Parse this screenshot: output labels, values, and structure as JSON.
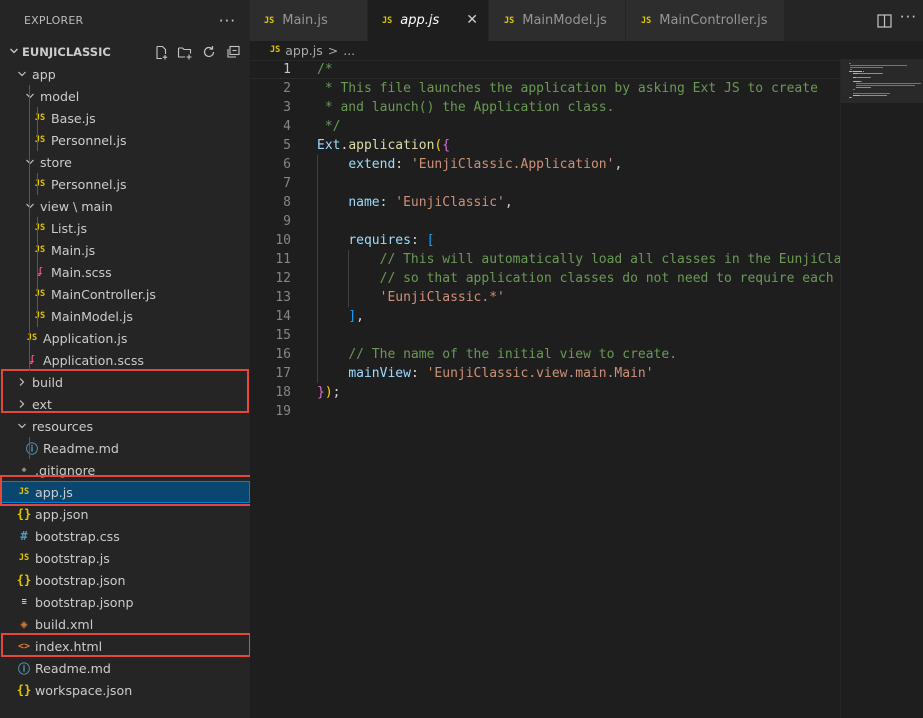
{
  "explorer": {
    "header_label": "EXPLORER",
    "more_icon": "ellipsis-icon",
    "project_name": "EUNJICLASSIC",
    "actions": [
      "new-file-icon",
      "new-folder-icon",
      "refresh-icon",
      "collapse-all-icon"
    ]
  },
  "tree": [
    {
      "label": "app",
      "kind": "folder",
      "expanded": true,
      "depth": 1
    },
    {
      "label": "model",
      "kind": "folder",
      "expanded": true,
      "depth": 2
    },
    {
      "label": "Base.js",
      "kind": "js",
      "depth": 3
    },
    {
      "label": "Personnel.js",
      "kind": "js",
      "depth": 3
    },
    {
      "label": "store",
      "kind": "folder",
      "expanded": true,
      "depth": 2
    },
    {
      "label": "Personnel.js",
      "kind": "js",
      "depth": 3
    },
    {
      "label": "view \\ main",
      "kind": "folder",
      "expanded": true,
      "depth": 2
    },
    {
      "label": "List.js",
      "kind": "js",
      "depth": 3
    },
    {
      "label": "Main.js",
      "kind": "js",
      "depth": 3
    },
    {
      "label": "Main.scss",
      "kind": "sass",
      "depth": 3
    },
    {
      "label": "MainController.js",
      "kind": "js",
      "depth": 3
    },
    {
      "label": "MainModel.js",
      "kind": "js",
      "depth": 3
    },
    {
      "label": "Application.js",
      "kind": "js",
      "depth": 2
    },
    {
      "label": "Application.scss",
      "kind": "sass",
      "depth": 2
    },
    {
      "label": "build",
      "kind": "folder",
      "expanded": false,
      "depth": 1
    },
    {
      "label": "ext",
      "kind": "folder",
      "expanded": false,
      "depth": 1
    },
    {
      "label": "resources",
      "kind": "folder",
      "expanded": true,
      "depth": 1
    },
    {
      "label": "Readme.md",
      "kind": "info",
      "depth": 2
    },
    {
      "label": ".gitignore",
      "kind": "git",
      "depth": 1
    },
    {
      "label": "app.js",
      "kind": "js",
      "depth": 1,
      "selected": true
    },
    {
      "label": "app.json",
      "kind": "json",
      "depth": 1
    },
    {
      "label": "bootstrap.css",
      "kind": "css",
      "depth": 1
    },
    {
      "label": "bootstrap.js",
      "kind": "js",
      "depth": 1
    },
    {
      "label": "bootstrap.json",
      "kind": "json",
      "depth": 1
    },
    {
      "label": "bootstrap.jsonp",
      "kind": "plain",
      "depth": 1
    },
    {
      "label": "build.xml",
      "kind": "xml",
      "depth": 1
    },
    {
      "label": "index.html",
      "kind": "html",
      "depth": 1
    },
    {
      "label": "Readme.md",
      "kind": "info",
      "depth": 1
    },
    {
      "label": "workspace.json",
      "kind": "json",
      "depth": 1
    }
  ],
  "icon_glyphs": {
    "js": "JS",
    "json": "{}",
    "css": "#",
    "info": "ⓘ",
    "html": "<>",
    "xml": "◈",
    "git": "◆",
    "sass": "ʆ",
    "plain": "≡"
  },
  "tabs": [
    {
      "label": "Main.js",
      "icon": "JS",
      "active": false
    },
    {
      "label": "app.js",
      "icon": "JS",
      "active": true
    },
    {
      "label": "MainModel.js",
      "icon": "JS",
      "active": false
    },
    {
      "label": "MainController.js",
      "icon": "JS",
      "active": false
    }
  ],
  "tab_close_glyph": "✕",
  "breadcrumb": {
    "icon": "JS",
    "file": "app.js",
    "separator": ">",
    "tail": "..."
  },
  "editor": {
    "current_line": 1,
    "lines": [
      [
        [
          "t-com",
          "/*"
        ]
      ],
      [
        [
          "t-com",
          " * This file launches the application by asking Ext JS to create"
        ]
      ],
      [
        [
          "t-com",
          " * and launch() the Application class."
        ]
      ],
      [
        [
          "t-com",
          " */"
        ]
      ],
      [
        [
          "t-var",
          "Ext"
        ],
        [
          "t-pun",
          "."
        ],
        [
          "t-fn",
          "application"
        ],
        [
          "t-b1",
          "("
        ],
        [
          "t-b2",
          "{"
        ]
      ],
      [
        [
          "t-pun",
          "    "
        ],
        [
          "t-prop",
          "extend"
        ],
        [
          "t-pun",
          ": "
        ],
        [
          "t-str",
          "'EunjiClassic.Application'"
        ],
        [
          "t-pun",
          ","
        ]
      ],
      [],
      [
        [
          "t-pun",
          "    "
        ],
        [
          "t-prop",
          "name"
        ],
        [
          "t-pun",
          ": "
        ],
        [
          "t-str",
          "'EunjiClassic'"
        ],
        [
          "t-pun",
          ","
        ]
      ],
      [],
      [
        [
          "t-pun",
          "    "
        ],
        [
          "t-prop",
          "requires"
        ],
        [
          "t-pun",
          ": "
        ],
        [
          "t-b3",
          "["
        ]
      ],
      [
        [
          "t-pun",
          "        "
        ],
        [
          "t-com",
          "// This will automatically load all classes in the EunjiClassic namespace"
        ]
      ],
      [
        [
          "t-pun",
          "        "
        ],
        [
          "t-com",
          "// so that application classes do not need to require each other."
        ]
      ],
      [
        [
          "t-pun",
          "        "
        ],
        [
          "t-str",
          "'EunjiClassic.*'"
        ]
      ],
      [
        [
          "t-pun",
          "    "
        ],
        [
          "t-b3",
          "]"
        ],
        [
          "t-pun",
          ","
        ]
      ],
      [],
      [
        [
          "t-pun",
          "    "
        ],
        [
          "t-com",
          "// The name of the initial view to create."
        ]
      ],
      [
        [
          "t-pun",
          "    "
        ],
        [
          "t-prop",
          "mainView"
        ],
        [
          "t-pun",
          ": "
        ],
        [
          "t-str",
          "'EunjiClassic.view.main.Main'"
        ]
      ],
      [
        [
          "t-b2",
          "}"
        ],
        [
          "t-b1",
          ")"
        ],
        [
          "t-pun",
          ";"
        ]
      ],
      []
    ]
  },
  "colors": {
    "accent": "#007fd4",
    "selection": "#094771",
    "annotation_box": "#e5483b"
  }
}
